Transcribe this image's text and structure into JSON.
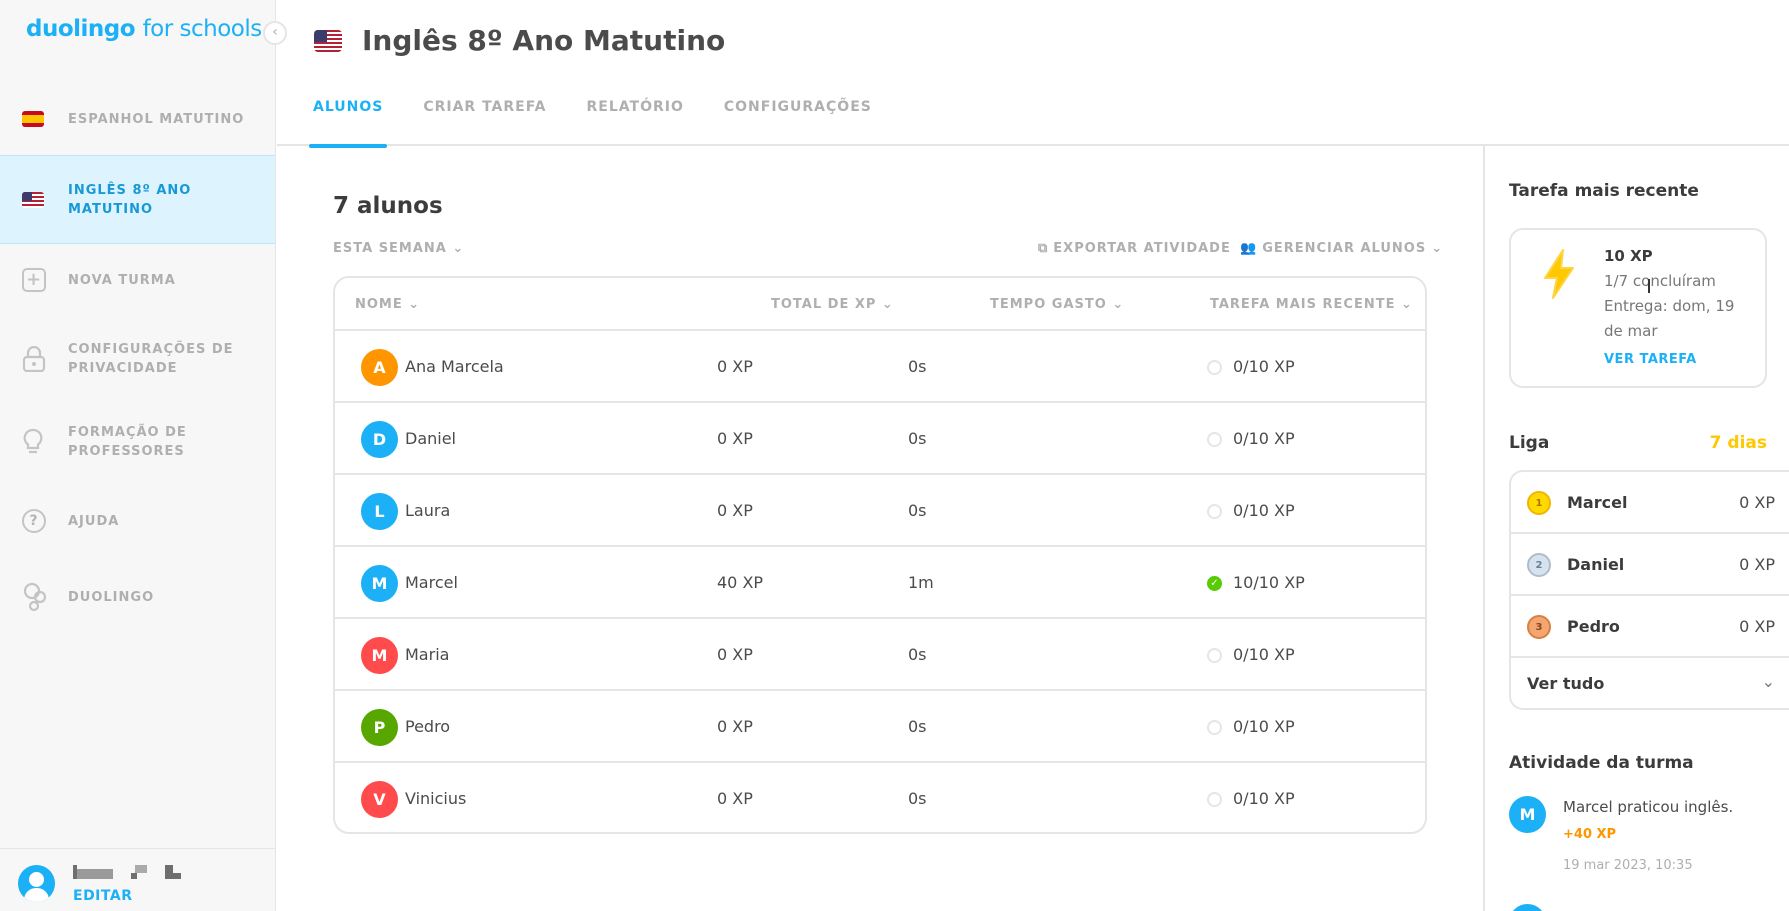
{
  "app": {
    "logo_brand": "duolingo",
    "logo_suffix": "for schools"
  },
  "sidebar": {
    "items": [
      {
        "label": "ESPANHOL MATUTINO",
        "icon": "spain-flag-icon"
      },
      {
        "label": "INGLÊS 8º ANO\nMATUTINO",
        "icon": "usa-flag-icon",
        "active": true
      },
      {
        "label": "NOVA TURMA",
        "icon": "plus-icon"
      },
      {
        "label": "CONFIGURAÇÕES DE\nPRIVACIDADE",
        "icon": "lock-icon"
      },
      {
        "label": "FORMAÇÃO DE\nPROFESSORES",
        "icon": "lightbulb-icon"
      },
      {
        "label": "AJUDA",
        "icon": "help-icon"
      },
      {
        "label": "DUOLINGO",
        "icon": "duolingo-icon"
      }
    ],
    "footer": {
      "edit_label": "EDITAR"
    }
  },
  "header": {
    "class_title": "Inglês 8º Ano Matutino",
    "tabs": [
      "ALUNOS",
      "CRIAR TAREFA",
      "RELATÓRIO",
      "CONFIGURAÇÕES"
    ]
  },
  "main": {
    "students_count": "7 alunos",
    "period_filter": "ESTA SEMANA",
    "export_label": "EXPORTAR ATIVIDADE",
    "manage_label": "GERENCIAR ALUNOS",
    "columns": [
      "NOME",
      "TOTAL DE XP",
      "TEMPO GASTO",
      "TAREFA MAIS RECENTE"
    ],
    "rows": [
      {
        "initial": "A",
        "name": "Ana Marcela",
        "xp": "0 XP",
        "time": "0s",
        "task": "0/10 XP",
        "done": false,
        "color": "#ff9600"
      },
      {
        "initial": "D",
        "name": "Daniel",
        "xp": "0 XP",
        "time": "0s",
        "task": "0/10 XP",
        "done": false,
        "color": "#1cb0f6"
      },
      {
        "initial": "L",
        "name": "Laura",
        "xp": "0 XP",
        "time": "0s",
        "task": "0/10 XP",
        "done": false,
        "color": "#1cb0f6"
      },
      {
        "initial": "M",
        "name": "Marcel",
        "xp": "40 XP",
        "time": "1m",
        "task": "10/10 XP",
        "done": true,
        "color": "#1cb0f6"
      },
      {
        "initial": "M",
        "name": "Maria",
        "xp": "0 XP",
        "time": "0s",
        "task": "0/10 XP",
        "done": false,
        "color": "#ff4b4b"
      },
      {
        "initial": "P",
        "name": "Pedro",
        "xp": "0 XP",
        "time": "0s",
        "task": "0/10 XP",
        "done": false,
        "color": "#58a700"
      },
      {
        "initial": "V",
        "name": "Vinicius",
        "xp": "0 XP",
        "time": "0s",
        "task": "0/10 XP",
        "done": false,
        "color": "#ff4b4b"
      }
    ]
  },
  "right_panel": {
    "recent_task_heading": "Tarefa mais recente",
    "task": {
      "xp": "10 XP",
      "completed": "1/7 concluíram",
      "due_line1": "Entrega: dom, 19",
      "due_line2": "de mar",
      "link": "VER TAREFA"
    },
    "league_heading": "Liga",
    "league_days": "7 dias",
    "league": [
      {
        "rank": "1",
        "name": "Marcel",
        "xp": "0 XP",
        "medal": "gold"
      },
      {
        "rank": "2",
        "name": "Daniel",
        "xp": "0 XP",
        "medal": "silver"
      },
      {
        "rank": "3",
        "name": "Pedro",
        "xp": "0 XP",
        "medal": "bronze"
      }
    ],
    "see_all": "Ver tudo",
    "activity_heading": "Atividade da turma",
    "activity": {
      "initial": "M",
      "text": "Marcel praticou inglês.",
      "xp": "+40 XP",
      "time": "19 mar 2023, 10:35"
    }
  },
  "colors": {
    "brand": "#1cb0f6",
    "done": "#58cc02",
    "league_gold": "#ffc800",
    "xp_orange": "#ff9600"
  }
}
